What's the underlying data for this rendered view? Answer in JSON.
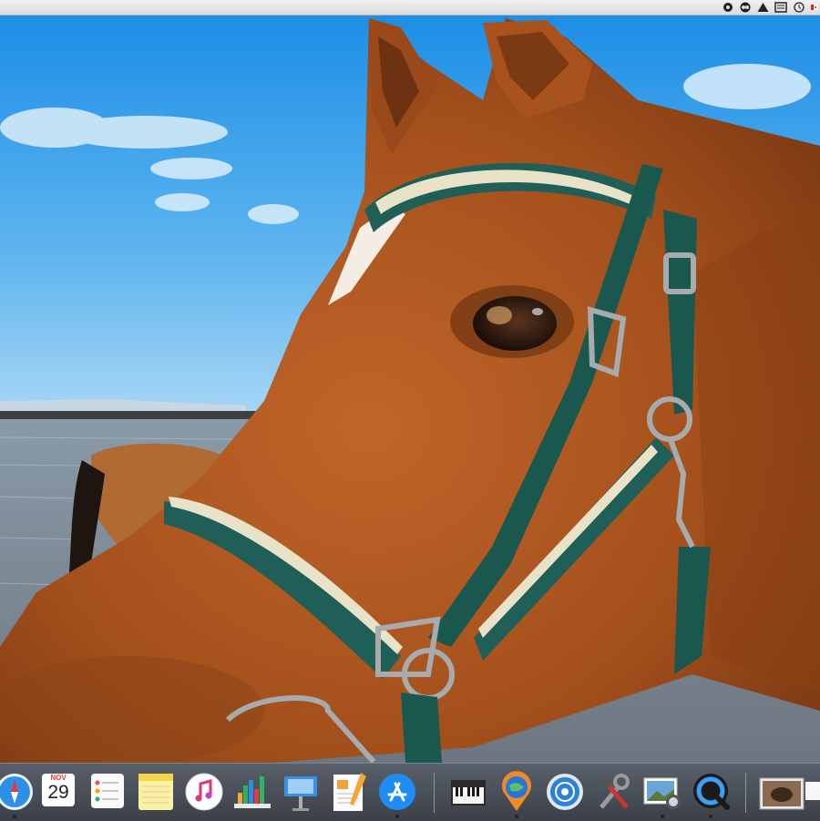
{
  "menubar": {
    "status_items": [
      "creative-cloud-icon",
      "camtasia-icon",
      "google-drive-icon",
      "notification-icon",
      "time-machine-icon",
      "flag-icon"
    ]
  },
  "wallpaper": {
    "subject": "horse-with-green-bridle-on-beach"
  },
  "dock": {
    "calendar": {
      "month": "NOV",
      "day": "29"
    },
    "apps": [
      "safari-icon",
      "calendar-icon",
      "reminders-icon",
      "notes-icon",
      "itunes-icon",
      "numbers-icon",
      "keynote-icon",
      "pages-icon",
      "app-store-icon",
      "piano-icon",
      "maps-pin-icon",
      "network-radar-icon",
      "system-tools-icon",
      "preview-icon",
      "quicktime-icon",
      "photos-stack-icon"
    ]
  },
  "colors": {
    "sky": "#4aa6ea",
    "horse": "#b0561f",
    "bridle": "#1f5f57",
    "dock": "#4a5058"
  }
}
